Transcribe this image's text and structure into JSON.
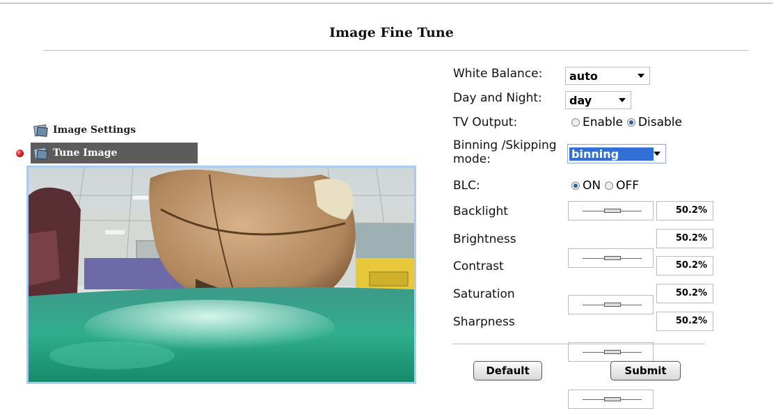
{
  "page": {
    "title": "Image Fine Tune"
  },
  "nav": {
    "items": [
      {
        "label": "Image Settings",
        "icon": "image-stack-icon",
        "active": false
      },
      {
        "label": "Tune Image",
        "icon": "image-tune-icon",
        "active": true
      }
    ],
    "active_marker_color": "#e02020",
    "active_bg_color": "#5c5c5c"
  },
  "preview": {
    "icon": "camera-preview-image",
    "frame_color": "#a9cbee"
  },
  "form": {
    "white_balance": {
      "label": "White Balance:",
      "value": "auto"
    },
    "day_night": {
      "label": "Day and Night:",
      "value": "day"
    },
    "tv_output": {
      "label": "TV Output:",
      "options": [
        "Enable",
        "Disable"
      ],
      "selected": "Disable"
    },
    "binning": {
      "label_line1": "Binning /Skipping",
      "label_line2": "mode:",
      "value": "binning"
    },
    "blc": {
      "label": "BLC:",
      "options": [
        "ON",
        "OFF"
      ],
      "selected": "ON"
    },
    "sliders": [
      {
        "label": "Backlight",
        "value": "50.2%",
        "level": 0.502
      },
      {
        "label": "Brightness",
        "value": "50.2%",
        "level": 0.502
      },
      {
        "label": "Contrast",
        "value": "50.2%",
        "level": 0.502
      },
      {
        "label": "Saturation",
        "value": "50.2%",
        "level": 0.502
      },
      {
        "label": "Sharpness",
        "value": "50.2%",
        "level": 0.502
      }
    ]
  },
  "buttons": {
    "default_label": "Default",
    "submit_label": "Submit"
  }
}
